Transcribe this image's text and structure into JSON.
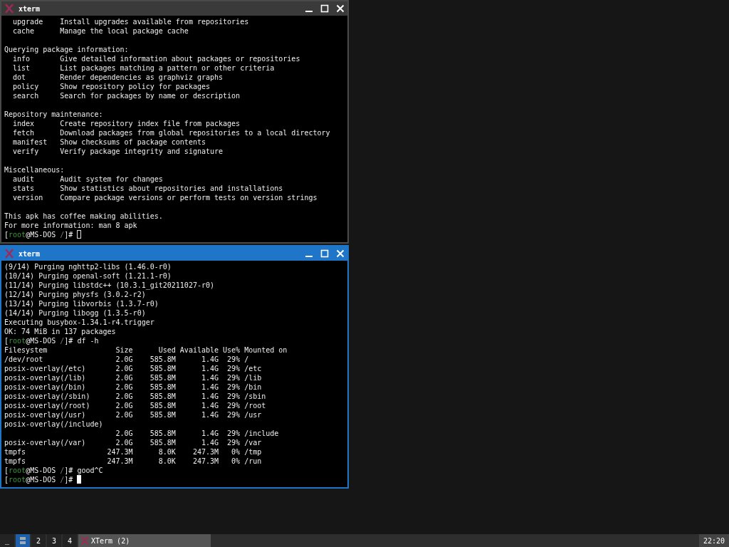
{
  "windows": [
    {
      "title": "xterm",
      "focused": false,
      "lines": [
        {
          "kind": "text",
          "text": "  upgrade    Install upgrades available from repositories"
        },
        {
          "kind": "text",
          "text": "  cache      Manage the local package cache"
        },
        {
          "kind": "blank"
        },
        {
          "kind": "text",
          "text": "Querying package information:"
        },
        {
          "kind": "text",
          "text": "  info       Give detailed information about packages or repositories"
        },
        {
          "kind": "text",
          "text": "  list       List packages matching a pattern or other criteria"
        },
        {
          "kind": "text",
          "text": "  dot        Render dependencies as graphviz graphs"
        },
        {
          "kind": "text",
          "text": "  policy     Show repository policy for packages"
        },
        {
          "kind": "text",
          "text": "  search     Search for packages by name or description"
        },
        {
          "kind": "blank"
        },
        {
          "kind": "text",
          "text": "Repository maintenance:"
        },
        {
          "kind": "text",
          "text": "  index      Create repository index file from packages"
        },
        {
          "kind": "text",
          "text": "  fetch      Download packages from global repositories to a local directory"
        },
        {
          "kind": "text",
          "text": "  manifest   Show checksums of package contents"
        },
        {
          "kind": "text",
          "text": "  verify     Verify package integrity and signature"
        },
        {
          "kind": "blank"
        },
        {
          "kind": "text",
          "text": "Miscellaneous:"
        },
        {
          "kind": "text",
          "text": "  audit      Audit system for changes"
        },
        {
          "kind": "text",
          "text": "  stats      Show statistics about repositories and installations"
        },
        {
          "kind": "text",
          "text": "  version    Compare package versions or perform tests on version strings"
        },
        {
          "kind": "blank"
        },
        {
          "kind": "text",
          "text": "This apk has coffee making abilities."
        },
        {
          "kind": "text",
          "text": "For more information: man 8 apk"
        },
        {
          "kind": "prompt",
          "open": "[",
          "user": "root",
          "host": "@MS-DOS ",
          "dir": "/",
          "close": "]# ",
          "cursor": true
        }
      ]
    },
    {
      "title": "xterm",
      "focused": true,
      "lines": [
        {
          "kind": "text",
          "text": "(9/14) Purging nghttp2-libs (1.46.0-r0)"
        },
        {
          "kind": "text",
          "text": "(10/14) Purging openal-soft (1.21.1-r0)"
        },
        {
          "kind": "text",
          "text": "(11/14) Purging libstdc++ (10.3.1_git20211027-r0)"
        },
        {
          "kind": "text",
          "text": "(12/14) Purging physfs (3.0.2-r2)"
        },
        {
          "kind": "text",
          "text": "(13/14) Purging libvorbis (1.3.7-r0)"
        },
        {
          "kind": "text",
          "text": "(14/14) Purging libogg (1.3.5-r0)"
        },
        {
          "kind": "text",
          "text": "Executing busybox-1.34.1-r4.trigger"
        },
        {
          "kind": "text",
          "text": "OK: 74 MiB in 137 packages"
        },
        {
          "kind": "prompt",
          "open": "[",
          "user": "root",
          "host": "@MS-DOS ",
          "dir": "/",
          "close": "]# ",
          "command": "df -h",
          "cursor": false
        },
        {
          "kind": "text",
          "text": "Filesystem                Size      Used Available Use% Mounted on"
        },
        {
          "kind": "text",
          "text": "/dev/root                 2.0G    585.8M      1.4G  29% /"
        },
        {
          "kind": "text",
          "text": "posix-overlay(/etc)       2.0G    585.8M      1.4G  29% /etc"
        },
        {
          "kind": "text",
          "text": "posix-overlay(/lib)       2.0G    585.8M      1.4G  29% /lib"
        },
        {
          "kind": "text",
          "text": "posix-overlay(/bin)       2.0G    585.8M      1.4G  29% /bin"
        },
        {
          "kind": "text",
          "text": "posix-overlay(/sbin)      2.0G    585.8M      1.4G  29% /sbin"
        },
        {
          "kind": "text",
          "text": "posix-overlay(/root)      2.0G    585.8M      1.4G  29% /root"
        },
        {
          "kind": "text",
          "text": "posix-overlay(/usr)       2.0G    585.8M      1.4G  29% /usr"
        },
        {
          "kind": "text",
          "text": "posix-overlay(/include)"
        },
        {
          "kind": "text",
          "text": "                          2.0G    585.8M      1.4G  29% /include"
        },
        {
          "kind": "text",
          "text": "posix-overlay(/var)       2.0G    585.8M      1.4G  29% /var"
        },
        {
          "kind": "text",
          "text": "tmpfs                   247.3M      8.0K    247.3M   0% /tmp"
        },
        {
          "kind": "text",
          "text": "tmpfs                   247.3M      8.0K    247.3M   0% /run"
        },
        {
          "kind": "prompt",
          "open": "[",
          "user": "root",
          "host": "@MS-DOS ",
          "dir": "/",
          "close": "]# ",
          "command": "good^C",
          "cursor": false
        },
        {
          "kind": "prompt",
          "open": "[",
          "user": "root",
          "host": "@MS-DOS ",
          "dir": "/",
          "close": "]# ",
          "cursor": true
        }
      ]
    }
  ],
  "taskbar": {
    "show_desktop": "_",
    "workspaces": [
      {
        "kind": "icon",
        "selected": true
      },
      {
        "kind": "number",
        "label": "2",
        "selected": false
      },
      {
        "kind": "number",
        "label": "3",
        "selected": false
      },
      {
        "kind": "number",
        "label": "4",
        "selected": false
      }
    ],
    "task": "XTerm (2)",
    "clock": "22:20"
  }
}
